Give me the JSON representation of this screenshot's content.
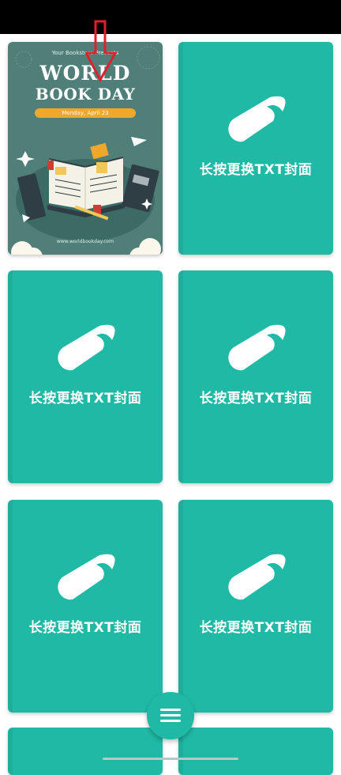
{
  "cover_placeholder_label": "长按更换TXT封面",
  "featured_cover": {
    "presents": "Your Bookstore Presents",
    "title_line1": "WORLD",
    "title_line2": "BOOK DAY",
    "date": "Monday, April 23",
    "website": "www.worldbookday.com"
  },
  "colors": {
    "accent": "#1fb9a6",
    "annotation": "#e0202a"
  },
  "icons": {
    "fab": "hamburger-menu-icon",
    "placeholder": "book-icon"
  }
}
